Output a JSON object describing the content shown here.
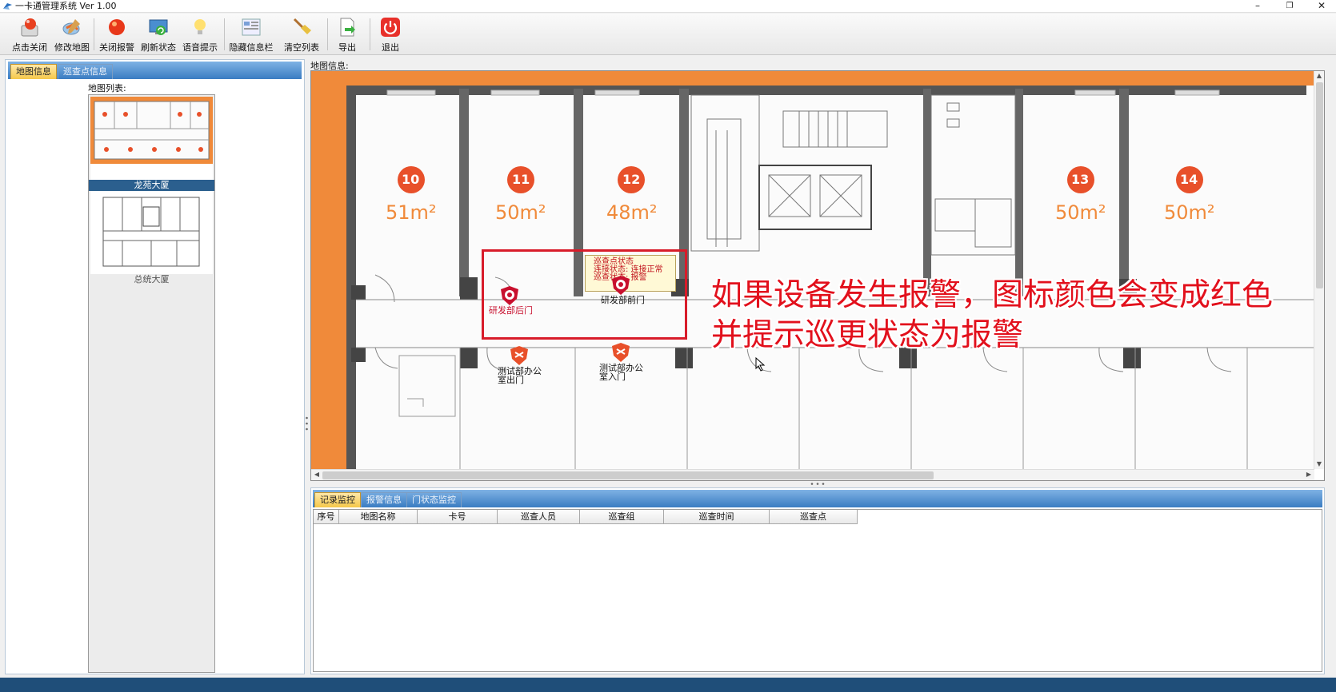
{
  "window": {
    "title": "一卡通管理系统  Ver 1.00",
    "minimize": "–",
    "restore": "❐",
    "close": "✕"
  },
  "toolbar": {
    "buttons": [
      {
        "label": "点击关闭",
        "icon": "alarm-close-icon"
      },
      {
        "label": "修改地图",
        "icon": "edit-map-icon"
      },
      {
        "label": "关闭报警",
        "icon": "alarm-off-icon"
      },
      {
        "label": "刷新状态",
        "icon": "refresh-icon"
      },
      {
        "label": "语音提示",
        "icon": "bulb-icon"
      },
      {
        "label": "隐藏信息栏",
        "icon": "hide-panel-icon"
      },
      {
        "label": "清空列表",
        "icon": "broom-icon"
      },
      {
        "label": "导出",
        "icon": "export-icon"
      },
      {
        "label": "退出",
        "icon": "power-icon"
      }
    ]
  },
  "left_panel": {
    "tabs": [
      {
        "label": "地图信息",
        "active": true
      },
      {
        "label": "巡查点信息",
        "active": false
      }
    ],
    "map_list_label": "地图列表:",
    "maps": [
      {
        "name": "龙苑大厦",
        "selected": true
      },
      {
        "name": "总统大厦",
        "selected": false
      }
    ]
  },
  "map_panel": {
    "title": "地图信息:",
    "rooms": [
      {
        "number": "10",
        "area": "51m²"
      },
      {
        "number": "11",
        "area": "50m²"
      },
      {
        "number": "12",
        "area": "48m²"
      },
      {
        "number": "13",
        "area": "50m²"
      },
      {
        "number": "14",
        "area": "50m²"
      }
    ],
    "markers": [
      {
        "label": "研发部后门",
        "status": "alarm"
      },
      {
        "label": "研发部前门",
        "status": "alarm"
      },
      {
        "label": "测试部办公室出门",
        "status": "normal"
      },
      {
        "label": "测试部办公室入门",
        "status": "normal"
      }
    ],
    "tooltip": {
      "line1": "巡查点状态",
      "line2": "连接状态: 连接正常",
      "line3": "巡查状态: 报警"
    },
    "callout_line1": "如果设备发生报警，图标颜色会变成红色",
    "callout_line2": "并提示巡更状态为报警",
    "colors": {
      "alarm": "#c8102e",
      "normal": "#e8502a",
      "floor_border": "#f08a3a"
    }
  },
  "bottom_panel": {
    "tabs": [
      {
        "label": "记录监控",
        "active": true
      },
      {
        "label": "报警信息",
        "active": false
      },
      {
        "label": "门状态监控",
        "active": false
      }
    ],
    "columns": [
      "序号",
      "地图名称",
      "卡号",
      "巡查人员",
      "巡查组",
      "巡查时间",
      "巡查点"
    ],
    "rows": []
  }
}
